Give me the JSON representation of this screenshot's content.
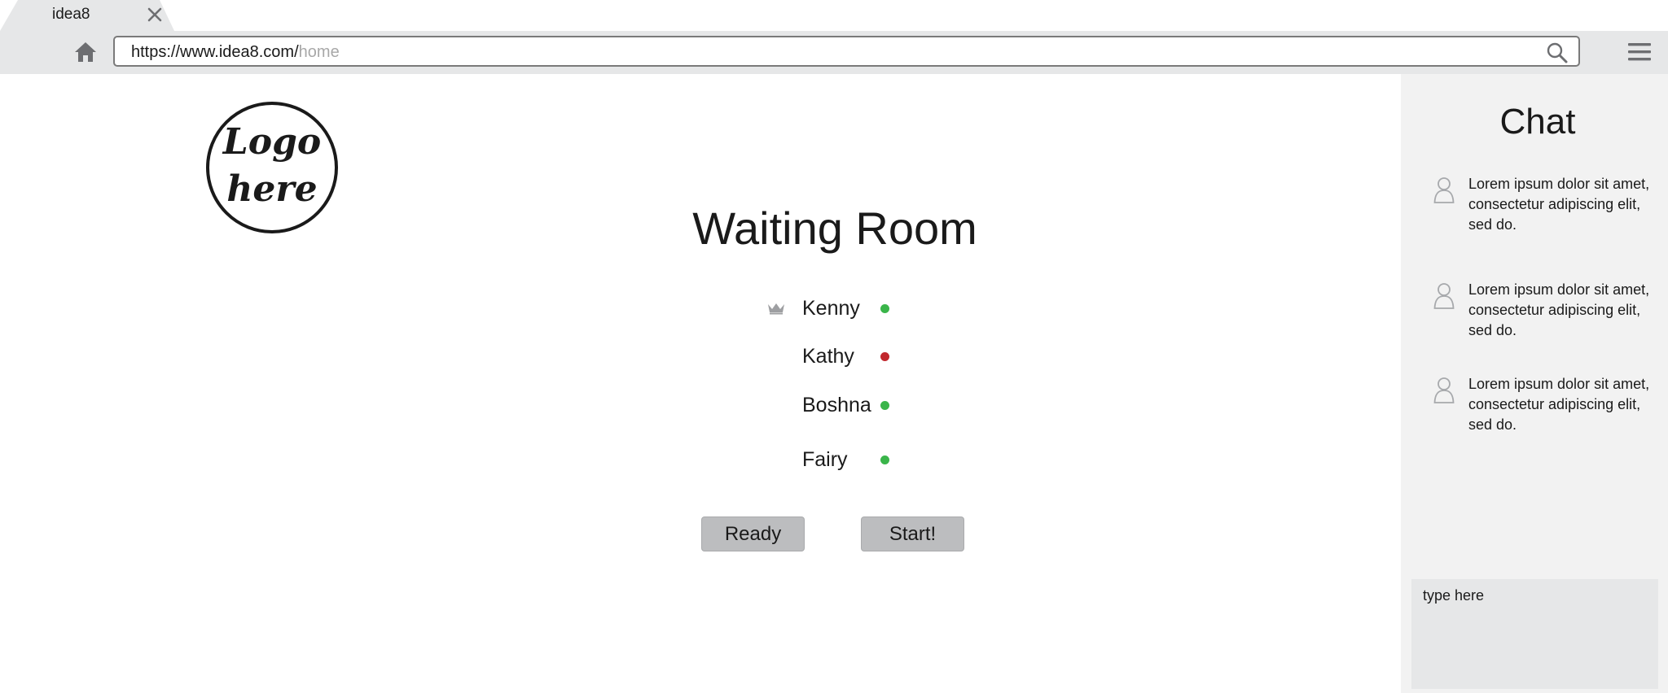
{
  "browser": {
    "tab_title": "idea8",
    "url_base": "https://www.idea8.com/",
    "url_path": "home"
  },
  "icons": {
    "tab_close": "close-icon",
    "home": "home-icon",
    "search": "search-icon",
    "menu": "hamburger-menu-icon",
    "host": "crown-icon",
    "chat_user": "user-icon"
  },
  "logo": {
    "line1": "Logo",
    "line2": "here"
  },
  "main": {
    "title": "Waiting Room",
    "players": [
      {
        "name": "Kenny",
        "status": "ready",
        "status_color": "#3ab54a",
        "host": true
      },
      {
        "name": "Kathy",
        "status": "not-ready",
        "status_color": "#c1272d",
        "host": false
      },
      {
        "name": "Boshna",
        "status": "ready",
        "status_color": "#3ab54a",
        "host": false
      },
      {
        "name": "Fairy",
        "status": "ready",
        "status_color": "#3ab54a",
        "host": false
      }
    ],
    "ready_label": "Ready",
    "start_label": "Start!"
  },
  "chat": {
    "title": "Chat",
    "messages": [
      {
        "text": "Lorem ipsum dolor sit amet,\n consectetur adipiscing elit,\nsed do."
      },
      {
        "text": "Lorem ipsum dolor sit amet,\n consectetur adipiscing elit,\nsed do."
      },
      {
        "text": "Lorem ipsum dolor sit amet,\n consectetur adipiscing elit,\nsed do."
      }
    ],
    "input_placeholder": "type here"
  },
  "colors": {
    "chrome_gray": "#e6e7e8",
    "button_gray": "#bcbdbf",
    "chat_panel": "#f2f2f2",
    "status_ready": "#3ab54a",
    "status_not_ready": "#c1272d"
  }
}
